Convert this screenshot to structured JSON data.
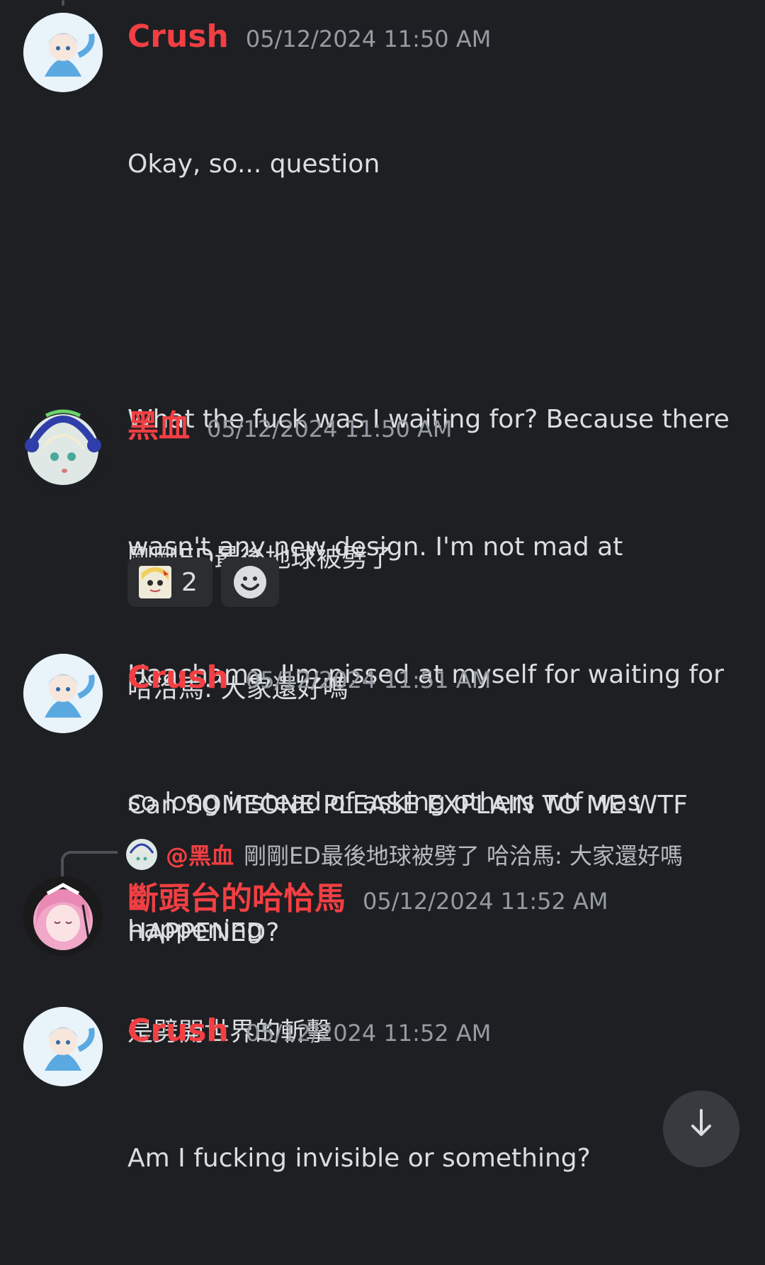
{
  "colors": {
    "background": "#1e1f22",
    "username": "#f23f43",
    "timestamp": "#949ba4",
    "text": "#dbdee1",
    "reaction_bg": "#2b2d31"
  },
  "messages": [
    {
      "username": "Crush",
      "timestamp": "05/12/2024 11:50 AM",
      "lines": [
        "Okay, so... question",
        "",
        "What the fuck was I waiting for? Because there",
        "wasn't any new design. I'm not mad at",
        "Haachama, I'm pissed at myself for waiting for",
        "so long instead of asking others wtf was",
        "happening"
      ]
    },
    {
      "username": "黑血",
      "timestamp": "05/12/2024 11:50 AM",
      "lines": [
        "剛剛ED最後地球被劈了",
        "哈洽馬: 大家還好嗎"
      ],
      "reactions": [
        {
          "emoji": "haato-face-emoji",
          "count": "2"
        },
        {
          "emoji": "add-reaction-icon"
        }
      ]
    },
    {
      "username": "Crush",
      "timestamp": "05/12/2024 11:51 AM",
      "lines": [
        "Can SOMEONE PLEASE EXPLAIN TO ME WTF",
        "HAPPENED?"
      ]
    },
    {
      "reply": {
        "user": "@黑血",
        "text": "剛剛ED最後地球被劈了 哈洽馬: 大家還好嗎"
      },
      "username": "斷頭台的哈恰馬",
      "timestamp": "05/12/2024 11:52 AM",
      "lines": [
        "是劈開世界的斬擊"
      ]
    },
    {
      "username": "Crush",
      "timestamp": "05/12/2024 11:52 AM",
      "lines": [
        "Am I fucking invisible or something?"
      ]
    }
  ],
  "scroll_button": {
    "icon": "arrow-down-icon"
  }
}
